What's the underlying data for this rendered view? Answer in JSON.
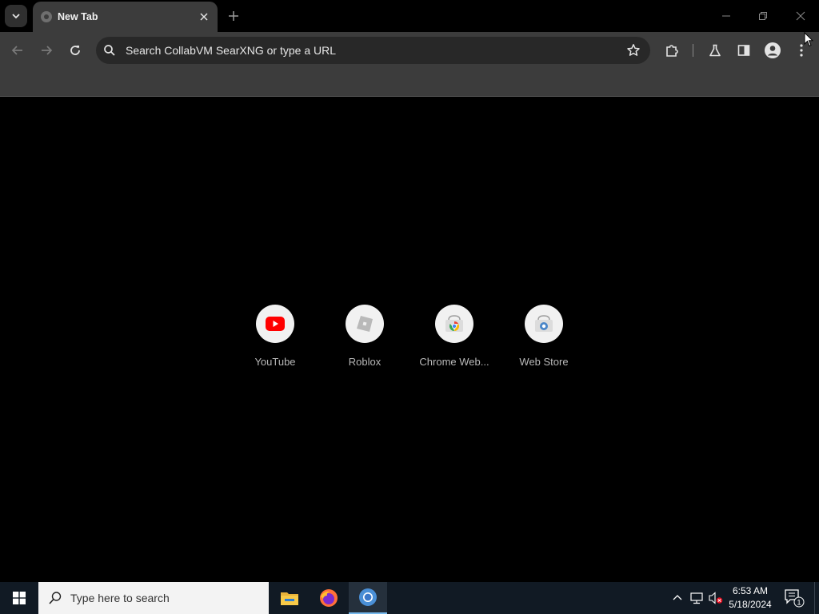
{
  "browser": {
    "tab": {
      "title": "New Tab"
    },
    "omnibox": {
      "placeholder": "Search CollabVM SearXNG or type a URL"
    }
  },
  "shortcuts": [
    {
      "label": "YouTube",
      "icon": "youtube-icon"
    },
    {
      "label": "Roblox",
      "icon": "roblox-icon"
    },
    {
      "label": "Chrome Web...",
      "icon": "chrome-web-store-icon"
    },
    {
      "label": "Web Store",
      "icon": "web-store-icon"
    }
  ],
  "taskbar": {
    "search_placeholder": "Type here to search",
    "apps": [
      "file-explorer-icon",
      "firefox-icon",
      "chrome-icon"
    ],
    "clock": {
      "time": "6:53 AM",
      "date": "5/18/2024"
    },
    "notification_count": "1"
  },
  "colors": {
    "toolbar": "#3c3c3c",
    "omnibox": "#282828",
    "content_bg": "#000000",
    "taskbar": "#111a24",
    "youtube_red": "#ff0000"
  }
}
